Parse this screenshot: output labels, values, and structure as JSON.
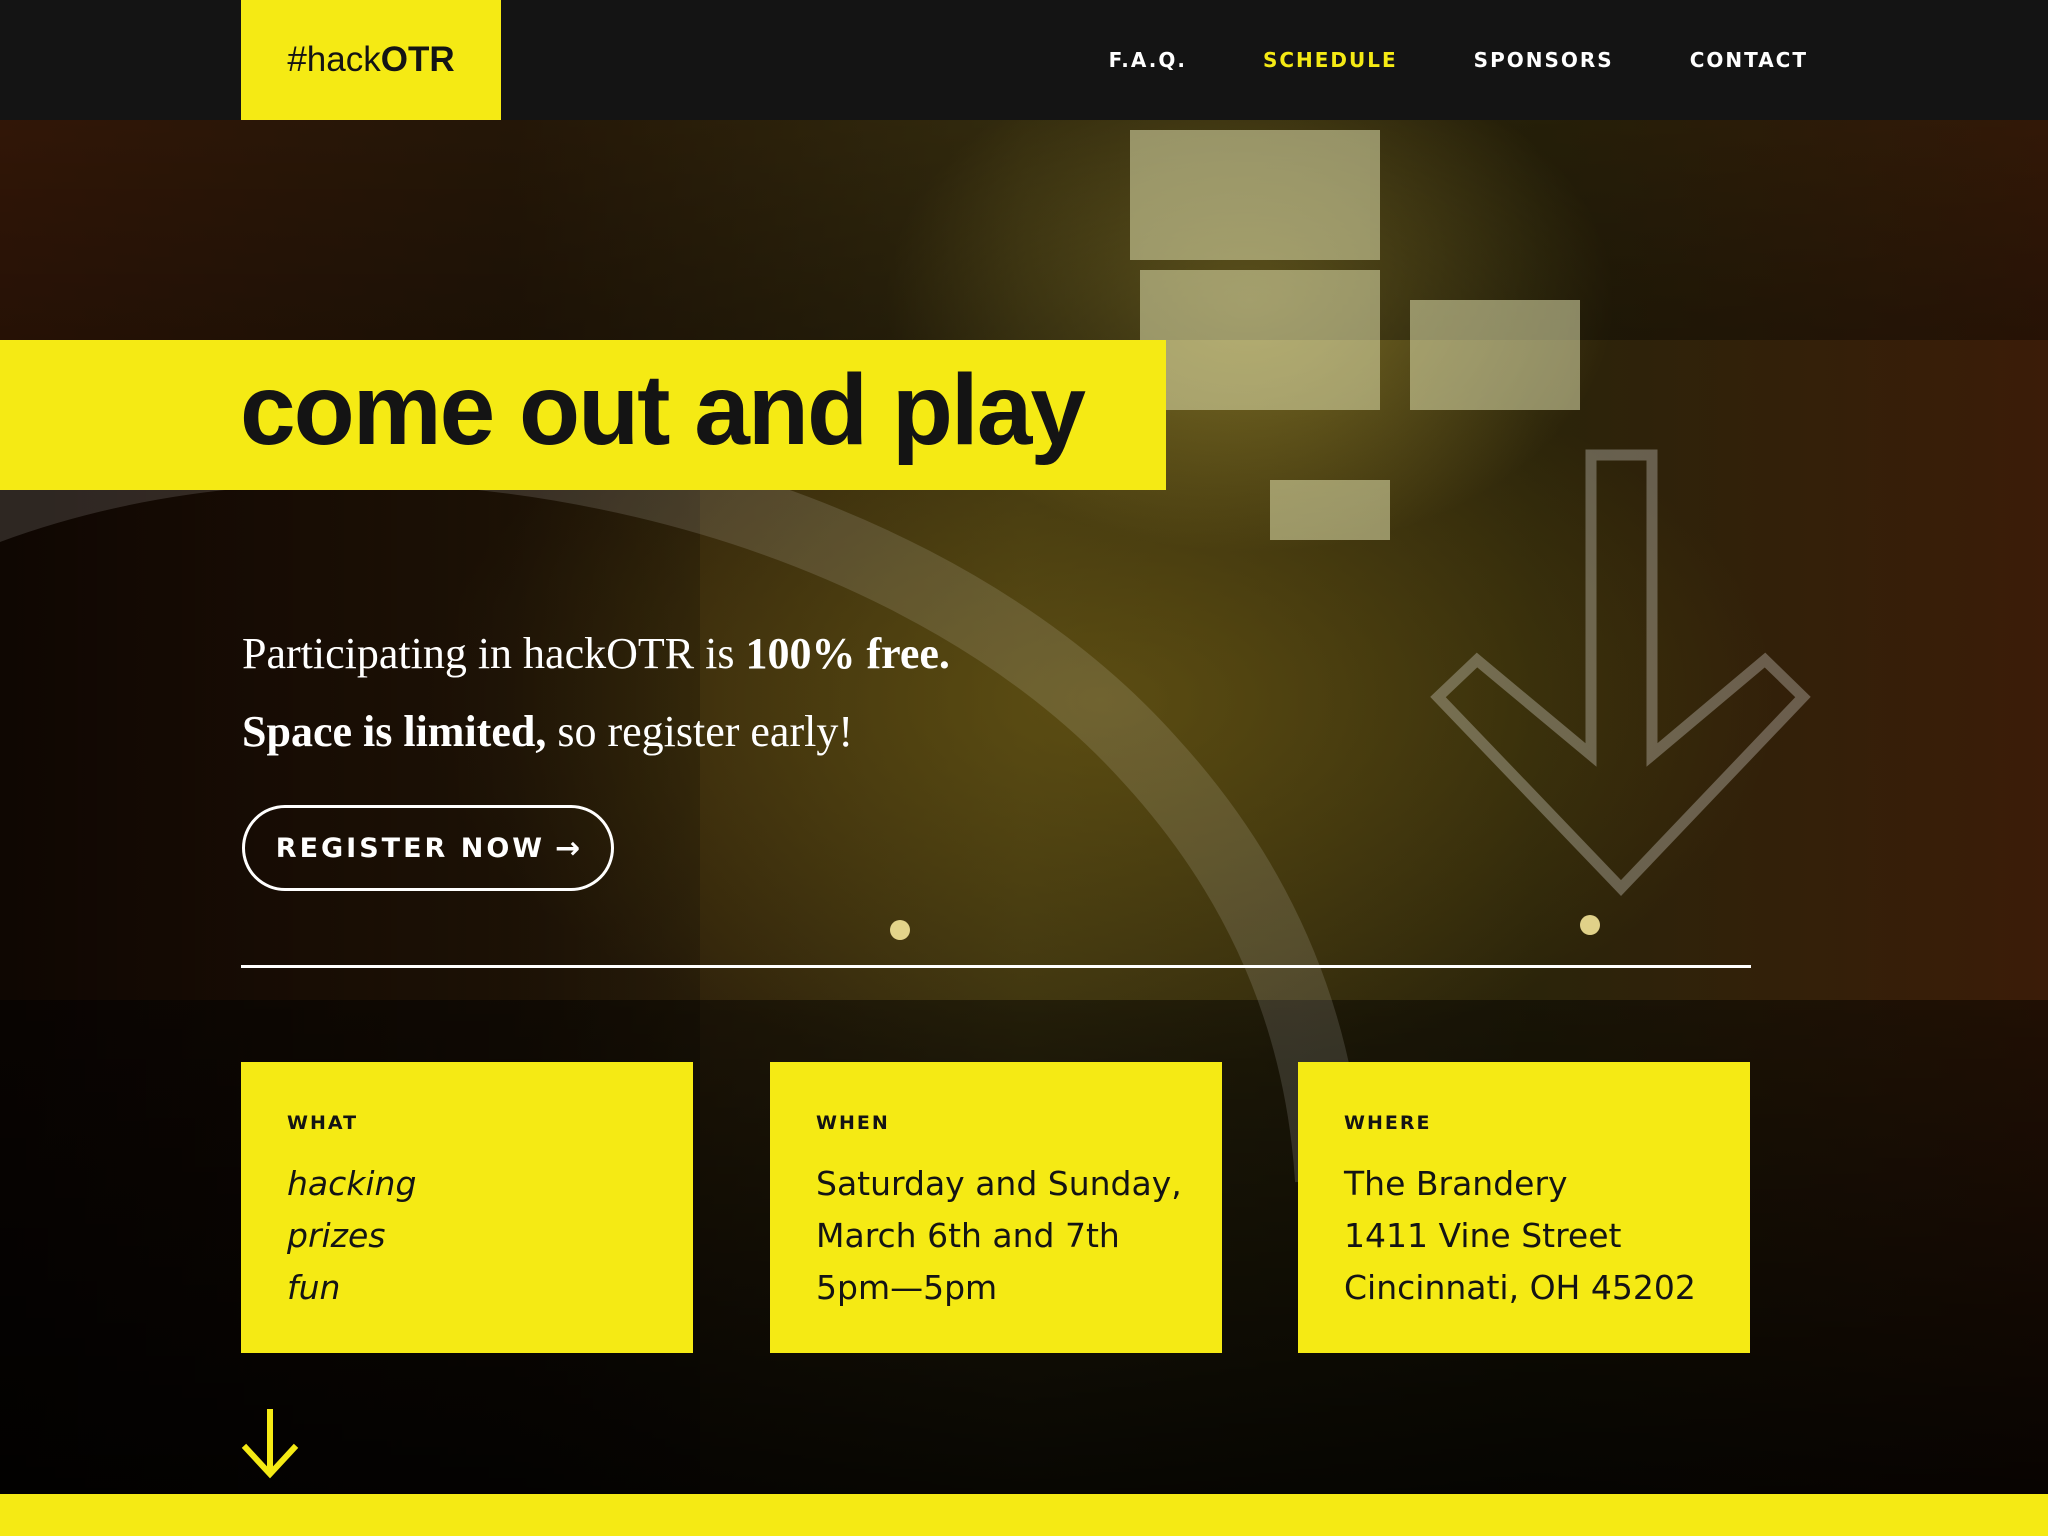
{
  "brand": {
    "prefix": "#hack",
    "strong": "OTR"
  },
  "nav": [
    {
      "label": "F.A.Q.",
      "active": false
    },
    {
      "label": "SCHEDULE",
      "active": true
    },
    {
      "label": "SPONSORS",
      "active": false
    },
    {
      "label": "CONTACT",
      "active": false
    }
  ],
  "hero": {
    "headline": "come out and play",
    "line1_normal": "Participating in hackOTR is ",
    "line1_bold": "100% free.",
    "line2_bold": "Space is limited,",
    "line2_normal": " so register early!",
    "register_label": "REGISTER NOW",
    "register_arrow": "→"
  },
  "cards": {
    "what": {
      "title": "WHAT",
      "lines": [
        "hacking",
        "prizes",
        "fun"
      ]
    },
    "when": {
      "title": "WHEN",
      "lines": [
        "Saturday and Sunday,",
        "March 6th and 7th",
        "5pm—5pm"
      ]
    },
    "where": {
      "title": "WHERE",
      "lines": [
        "The Brandery",
        "1411 Vine Street",
        "Cincinnati, OH 45202"
      ]
    }
  },
  "icons": {
    "scroll": "arrow-down-icon",
    "hero_decor": "large-arrow-down-outline-icon",
    "register": "arrow-right-icon"
  },
  "colors": {
    "accent": "#f5ea14",
    "nav_bg": "#141414",
    "text_dark": "#141414",
    "text_light": "#ffffff"
  }
}
